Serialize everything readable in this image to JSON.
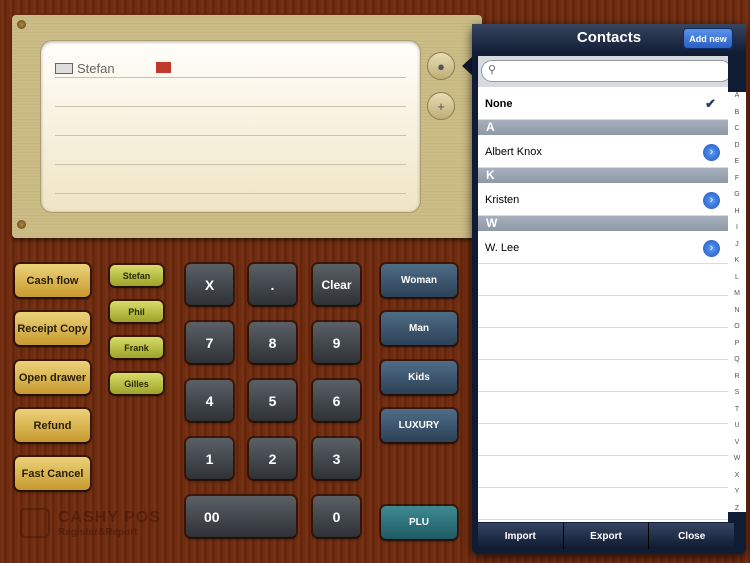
{
  "receipt": {
    "customer": "Stefan"
  },
  "left_buttons": [
    "Cash flow",
    "Receipt Copy",
    "Open drawer",
    "Refund",
    "Fast Cancel"
  ],
  "staff_buttons": [
    "Stefan",
    "Phil",
    "Frank",
    "Gilles"
  ],
  "keypad": {
    "rows": [
      [
        "X",
        ".",
        "Clear"
      ],
      [
        "7",
        "8",
        "9"
      ],
      [
        "4",
        "5",
        "6"
      ],
      [
        "1",
        "2",
        "3"
      ]
    ],
    "zero_zero": "00",
    "zero": "0"
  },
  "category_buttons": [
    "Woman",
    "Man",
    "Kids",
    "LUXURY"
  ],
  "plu_label": "PLU",
  "logo": {
    "name": "CASHY POS",
    "tagline": "Register&Report"
  },
  "contacts": {
    "title": "Contacts",
    "add_new": "Add new",
    "search_placeholder": "",
    "none_label": "None",
    "none_checked": true,
    "sections": [
      {
        "letter": "A",
        "items": [
          "Albert Knox"
        ]
      },
      {
        "letter": "K",
        "items": [
          "Kristen"
        ]
      },
      {
        "letter": "W",
        "items": [
          "W. Lee"
        ]
      }
    ],
    "index": [
      "A",
      "B",
      "C",
      "D",
      "E",
      "F",
      "G",
      "H",
      "I",
      "J",
      "K",
      "L",
      "M",
      "N",
      "O",
      "P",
      "Q",
      "R",
      "S",
      "T",
      "U",
      "V",
      "W",
      "X",
      "Y",
      "Z"
    ],
    "toolbar": [
      "Import",
      "Export",
      "Close"
    ]
  }
}
